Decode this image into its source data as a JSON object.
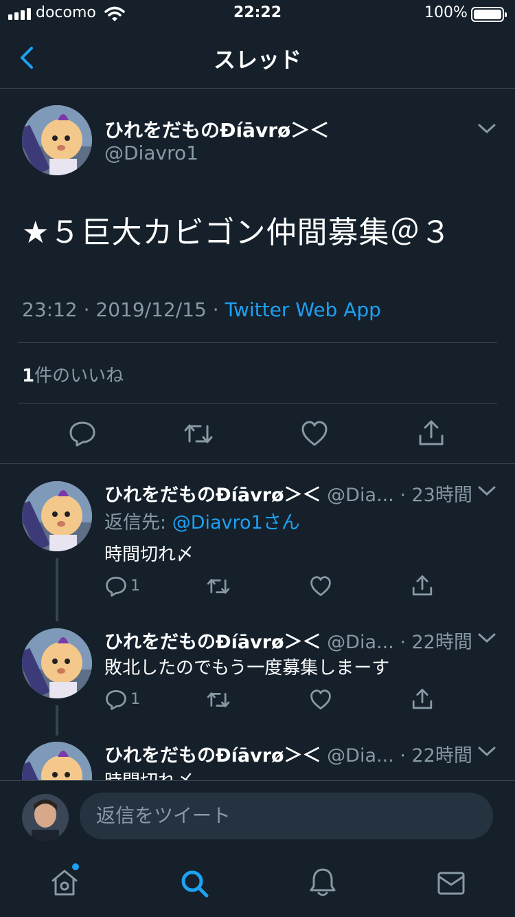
{
  "status_bar": {
    "carrier": "docomo",
    "time": "22:22",
    "battery": "100%"
  },
  "nav": {
    "title": "スレッド"
  },
  "main_tweet": {
    "display_name": "ひれをだものĐíāvrø＞＜",
    "handle": "@Diavro1",
    "text": "★５巨大カビゴン仲間募集＠３",
    "time": "23:12",
    "date": "2019/12/15",
    "source": "Twitter Web App",
    "likes_count": "1",
    "likes_label": "件のいいね"
  },
  "replies": [
    {
      "display_name": "ひれをだものĐíāvrø＞＜",
      "handle": "@Dia...",
      "time": "23時間",
      "reply_to_label": "返信先: ",
      "reply_to_user": "@Diavro1さん",
      "text": "時間切れ〆",
      "reply_count": "1"
    },
    {
      "display_name": "ひれをだものĐíāvrø＞＜",
      "handle": "@Dia...",
      "time": "22時間",
      "text": "敗北したのでもう一度募集しまーす",
      "reply_count": "1"
    },
    {
      "display_name": "ひれをだものĐíāvrø＞＜",
      "handle": "@Dia...",
      "time": "22時間",
      "text": "時間切れ〆"
    }
  ],
  "compose": {
    "placeholder": "返信をツイート"
  },
  "colors": {
    "background": "#15202b",
    "accent": "#1da1f2",
    "secondary_text": "#8899a6",
    "divider": "#38444d"
  },
  "icons": [
    "back-chevron-icon",
    "chevron-down-icon",
    "reply-icon",
    "retweet-icon",
    "like-icon",
    "share-icon",
    "home-icon",
    "search-icon",
    "notifications-icon",
    "messages-icon"
  ]
}
